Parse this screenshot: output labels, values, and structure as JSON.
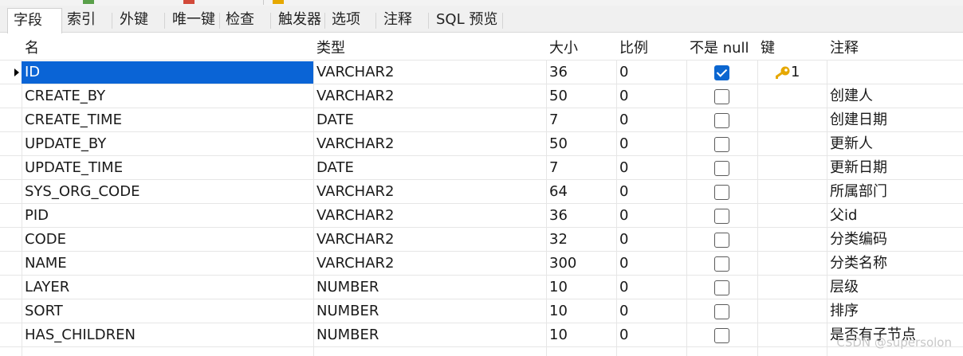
{
  "tabs": [
    {
      "label": "字段",
      "active": true
    },
    {
      "label": "索引"
    },
    {
      "label": "外键"
    },
    {
      "label": "唯一键"
    },
    {
      "label": "检查"
    },
    {
      "label": "触发器"
    },
    {
      "label": "选项"
    },
    {
      "label": "注释"
    },
    {
      "label": "SQL 预览"
    }
  ],
  "columns": {
    "name": "名",
    "type": "类型",
    "size": "大小",
    "scale": "比例",
    "not_null": "不是 null",
    "key": "键",
    "comment": "注释"
  },
  "rows": [
    {
      "name": "ID",
      "type": "VARCHAR2",
      "size": "36",
      "scale": "0",
      "not_null": true,
      "key": "1",
      "comment": ""
    },
    {
      "name": "CREATE_BY",
      "type": "VARCHAR2",
      "size": "50",
      "scale": "0",
      "not_null": false,
      "key": "",
      "comment": "创建人"
    },
    {
      "name": "CREATE_TIME",
      "type": "DATE",
      "size": "7",
      "scale": "0",
      "not_null": false,
      "key": "",
      "comment": "创建日期"
    },
    {
      "name": "UPDATE_BY",
      "type": "VARCHAR2",
      "size": "50",
      "scale": "0",
      "not_null": false,
      "key": "",
      "comment": "更新人"
    },
    {
      "name": "UPDATE_TIME",
      "type": "DATE",
      "size": "7",
      "scale": "0",
      "not_null": false,
      "key": "",
      "comment": "更新日期"
    },
    {
      "name": "SYS_ORG_CODE",
      "type": "VARCHAR2",
      "size": "64",
      "scale": "0",
      "not_null": false,
      "key": "",
      "comment": "所属部门"
    },
    {
      "name": "PID",
      "type": "VARCHAR2",
      "size": "36",
      "scale": "0",
      "not_null": false,
      "key": "",
      "comment": "父id"
    },
    {
      "name": "CODE",
      "type": "VARCHAR2",
      "size": "32",
      "scale": "0",
      "not_null": false,
      "key": "",
      "comment": "分类编码"
    },
    {
      "name": "NAME",
      "type": "VARCHAR2",
      "size": "300",
      "scale": "0",
      "not_null": false,
      "key": "",
      "comment": "分类名称"
    },
    {
      "name": "LAYER",
      "type": "NUMBER",
      "size": "10",
      "scale": "0",
      "not_null": false,
      "key": "",
      "comment": "层级"
    },
    {
      "name": "SORT",
      "type": "NUMBER",
      "size": "10",
      "scale": "0",
      "not_null": false,
      "key": "",
      "comment": "排序"
    },
    {
      "name": "HAS_CHILDREN",
      "type": "NUMBER",
      "size": "10",
      "scale": "0",
      "not_null": false,
      "key": "",
      "comment": "是否有子节点"
    }
  ],
  "key_icon": "key-icon",
  "colors": {
    "selection": "#0a64d6",
    "checkbox_on": "#0b66d0",
    "key_gold": "#e6a800"
  },
  "watermark": "CSDN @supersolon"
}
